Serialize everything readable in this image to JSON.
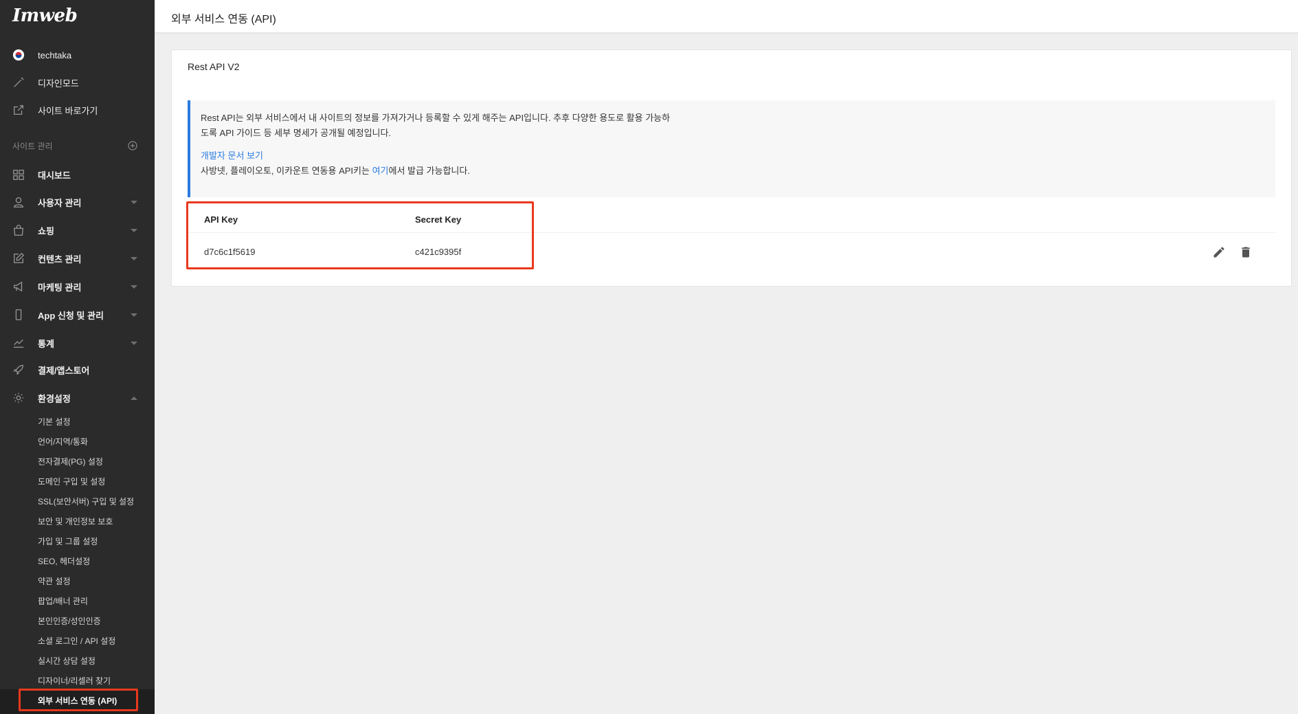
{
  "app": {
    "logo_text": "Imweb"
  },
  "sidebar": {
    "top_items": [
      {
        "label": "techtaka",
        "icon": "korea-flag-icon"
      },
      {
        "label": "디자인모드",
        "icon": "magic-wand-icon"
      },
      {
        "label": "사이트 바로가기",
        "icon": "external-link-icon"
      }
    ],
    "section_label": "사이트 관리",
    "section_add_icon": "plus-circle-icon",
    "menu_items": [
      {
        "label": "대시보드",
        "icon": "dashboard-icon",
        "caret": ""
      },
      {
        "label": "사용자 관리",
        "icon": "user-icon",
        "caret": "down"
      },
      {
        "label": "쇼핑",
        "icon": "shopping-bag-icon",
        "caret": "down"
      },
      {
        "label": "컨텐츠 관리",
        "icon": "edit-icon",
        "caret": "down"
      },
      {
        "label": "마케팅 관리",
        "icon": "megaphone-icon",
        "caret": "down"
      },
      {
        "label": "App 신청 및 관리",
        "icon": "mobile-icon",
        "caret": "down"
      },
      {
        "label": "통계",
        "icon": "chart-icon",
        "caret": "down"
      },
      {
        "label": "결제/앱스토어",
        "icon": "rocket-icon",
        "caret": ""
      },
      {
        "label": "환경설정",
        "icon": "gear-icon",
        "caret": "up"
      }
    ],
    "settings_sub_items": [
      "기본 설정",
      "언어/지역/통화",
      "전자결제(PG) 설정",
      "도메인 구입 및 설정",
      "SSL(보안서버) 구입 및 설정",
      "보안 및 개인정보 보호",
      "가입 및 그룹 설정",
      "SEO, 헤더설정",
      "약관 설정",
      "팝업/배너 관리",
      "본인인증/성인인증",
      "소셜 로그인 / API 설정",
      "실시간 상담 설정",
      "디자이너/리셀러 찾기",
      "외부 서비스 연동 (API)"
    ],
    "active_sub_item": "외부 서비스 연동 (API)"
  },
  "header": {
    "title": "외부 서비스 연동 (API)"
  },
  "card": {
    "title": "Rest API V2",
    "info": {
      "line1": "Rest API는 외부 서비스에서 내 사이트의 정보를 가져가거나 등록할 수 있게 해주는 API입니다. 추후 다양한 용도로 활용 가능하",
      "line2": "도록 API 가이드 등 세부 명세가 공개될 예정입니다.",
      "doc_link": "개발자 문서 보기",
      "line4_prefix": "사방넷, 플레이오토, 이카운트 연동용 API키는 ",
      "line4_link": "여기",
      "line4_suffix": "에서 발급 가능합니다."
    },
    "table": {
      "columns": [
        "API Key",
        "Secret Key"
      ],
      "rows": [
        {
          "api_key": "d7c6c1f5619",
          "secret_key": "c421c9395f"
        }
      ],
      "actions": {
        "edit_icon": "pencil-icon",
        "delete_icon": "trash-icon"
      }
    }
  },
  "colors": {
    "highlight": "#e8381e",
    "accent": "#2b7be0",
    "sidebar_bg": "#2b2b2b"
  }
}
